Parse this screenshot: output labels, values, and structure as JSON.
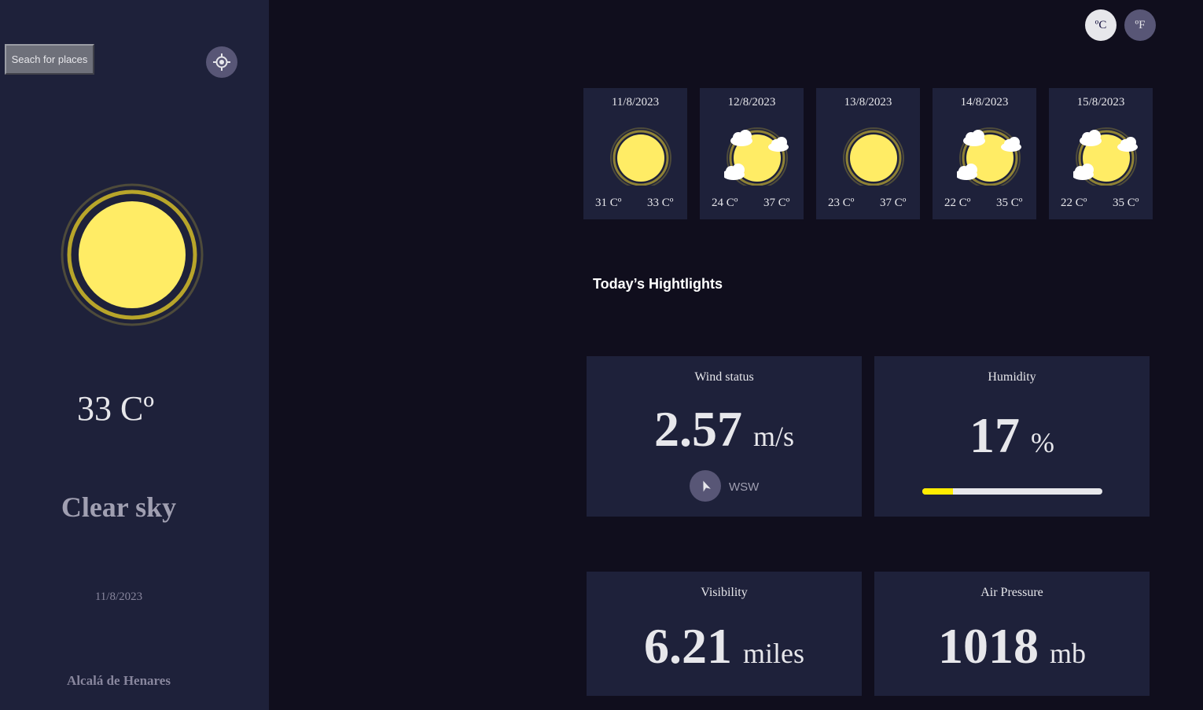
{
  "sidebar": {
    "search_label": "Seach for places",
    "locate_icon": "crosshair-icon",
    "current_icon": "sun-icon",
    "current_temp": "33 Cº",
    "condition": "Clear sky",
    "date": "11/8/2023",
    "location": "Alcalá de Henares"
  },
  "units": {
    "celsius": "ºC",
    "fahrenheit": "ºF"
  },
  "forecast": [
    {
      "date": "11/8/2023",
      "min": "31 Cº",
      "max": "33 Cº",
      "icon": "sun-icon"
    },
    {
      "date": "12/8/2023",
      "min": "24 Cº",
      "max": "37 Cº",
      "icon": "sun-clouds-icon"
    },
    {
      "date": "13/8/2023",
      "min": "23 Cº",
      "max": "37 Cº",
      "icon": "sun-icon"
    },
    {
      "date": "14/8/2023",
      "min": "22 Cº",
      "max": "35 Cº",
      "icon": "sun-clouds-icon"
    },
    {
      "date": "15/8/2023",
      "min": "22 Cº",
      "max": "35 Cº",
      "icon": "sun-clouds-icon"
    }
  ],
  "highlights": {
    "title": "Today’s Hightlights",
    "wind": {
      "label": "Wind status",
      "value": "2.57",
      "unit": "m/s",
      "direction": "WSW",
      "icon": "navigation-arrow-icon"
    },
    "humidity": {
      "label": "Humidity",
      "value": "17",
      "unit": "%",
      "percent": 17
    },
    "visibility": {
      "label": "Visibility",
      "value": "6.21",
      "unit": "miles"
    },
    "pressure": {
      "label": "Air Pressure",
      "value": "1018",
      "unit": "mb"
    }
  },
  "colors": {
    "sun": "#ffec65",
    "humidity_fill": "#ffec00",
    "sidebar_bg": "#1e213a",
    "page_bg": "#100e1d"
  }
}
